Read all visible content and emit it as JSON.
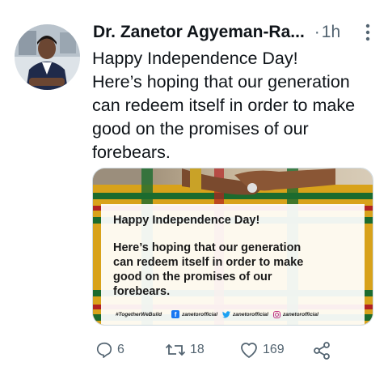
{
  "tweet": {
    "author_name": "Dr. Zanetor Agyeman-Ra...",
    "separator": "·",
    "time": "1h",
    "more_icon": "more-vertical-icon",
    "text_lines": [
      "Happy Independence Day!",
      "Here’s hoping that our generation",
      "can redeem itself in order to make",
      "good on the promises of our",
      "forebears."
    ]
  },
  "media": {
    "card_title": "Happy Independence Day!",
    "card_lines": [
      "Here’s hoping that our generation",
      "can redeem itself in order to make",
      "good on the promises of our",
      "forebears."
    ],
    "footer": {
      "hashtag": "#TogetherWeBuild",
      "facebook": "zanetorofficial",
      "twitter": "zanetorofficial",
      "instagram": "zanetorofficial"
    }
  },
  "actions": {
    "reply_count": "6",
    "retweet_count": "18",
    "like_count": "169",
    "share_icon": "share-icon"
  },
  "colors": {
    "text": "#0f1419",
    "secondary": "#536471",
    "border": "#cfd9de"
  }
}
